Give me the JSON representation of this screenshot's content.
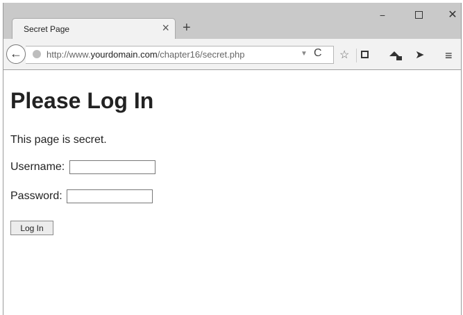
{
  "tab": {
    "title": "Secret Page",
    "close_glyph": "×",
    "new_tab_glyph": "+"
  },
  "window_controls": {
    "minimize": "−",
    "close": "✕"
  },
  "toolbar": {
    "back_glyph": "←",
    "url_prefix": "http://www.",
    "url_domain": "yourdomain.com",
    "url_path": "/chapter16/secret.php",
    "dropdown_glyph": "▼",
    "reload_glyph": "C",
    "star_glyph": "☆",
    "send_glyph": "➤",
    "menu_glyph": "≡"
  },
  "page": {
    "heading": "Please Log In",
    "message": "This page is secret.",
    "username_label": "Username:",
    "username_value": "",
    "password_label": "Password:",
    "password_value": "",
    "submit_label": "Log In"
  }
}
